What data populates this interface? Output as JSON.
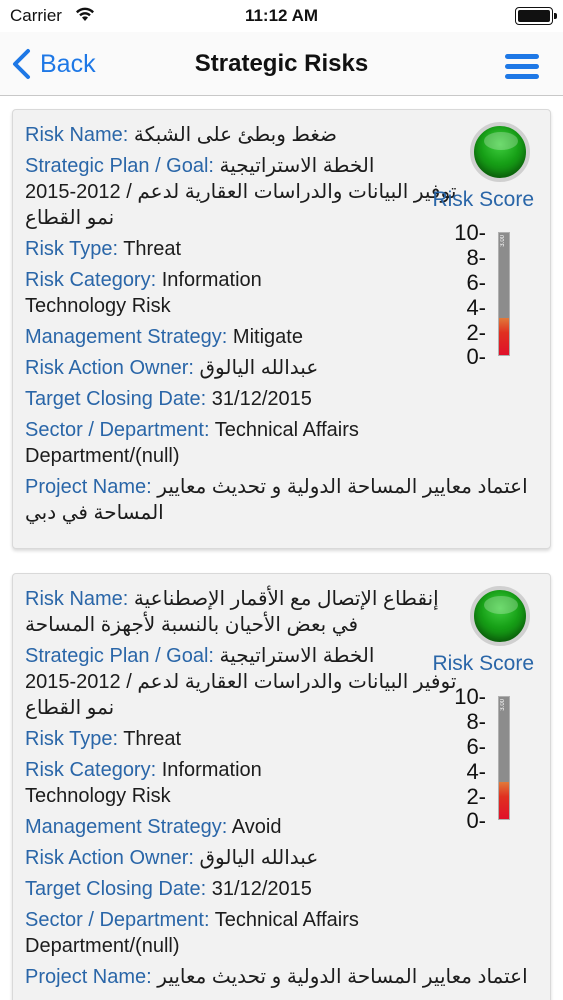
{
  "status_bar": {
    "carrier": "Carrier",
    "time": "11:12 AM"
  },
  "nav": {
    "back_label": "Back",
    "title": "Strategic Risks"
  },
  "labels": {
    "risk_name": "Risk Name:",
    "strategic_plan": "Strategic Plan / Goal:",
    "risk_type": "Risk Type:",
    "risk_category": "Risk Category:",
    "management_strategy": "Management Strategy:",
    "action_owner": "Risk Action Owner:",
    "target_closing_date": "Target Closing Date:",
    "sector": "Sector / Department:",
    "project_name": "Project Name:",
    "risk_score": "Risk Score"
  },
  "gauge_ticks": [
    "10-",
    "8-",
    "6-",
    "4-",
    "2-",
    "0-"
  ],
  "colors": {
    "accent": "#1e78e6",
    "label": "#2a66a8",
    "status_green": "#17a017",
    "gauge_red": "#e0102a",
    "gauge_gray": "#8c8c8c"
  },
  "risks": [
    {
      "risk_name": [
        "ضغط وبطئ على الشبكة"
      ],
      "strategic_plan": [
        "الخطة الاستراتيجية",
        "2015-2012 / توفير البيانات والدراسات العقارية لدعم",
        "نمو القطاع"
      ],
      "risk_type": "Threat",
      "risk_category": "Information Technology Risk",
      "management_strategy": "Mitigate",
      "action_owner": "عبدالله اليالوق",
      "target_closing_date": "31/12/2015",
      "sector": "Technical Affairs Department/(null)",
      "project_name": [
        "اعتماد معايير المساحة الدولية و تحديث معايير",
        "المساحة في دبي"
      ],
      "score": 3.0,
      "score_label": "3.00",
      "status_icon": "green-status-indicator"
    },
    {
      "risk_name": [
        "إنقطاع الإتصال مع الأقمار الإصطناعية",
        "في بعض الأحيان بالنسبة لأجهزة المساحة"
      ],
      "strategic_plan": [
        "الخطة الاستراتيجية",
        "2015-2012 / توفير البيانات والدراسات العقارية لدعم",
        "نمو القطاع"
      ],
      "risk_type": "Threat",
      "risk_category": "Information Technology Risk",
      "management_strategy": "Avoid",
      "action_owner": "عبدالله اليالوق",
      "target_closing_date": "31/12/2015",
      "sector": "Technical Affairs Department/(null)",
      "project_name": [
        "اعتماد معايير المساحة الدولية و تحديث معايير"
      ],
      "score": 3.0,
      "score_label": "3.00",
      "status_icon": "green-status-indicator"
    }
  ]
}
